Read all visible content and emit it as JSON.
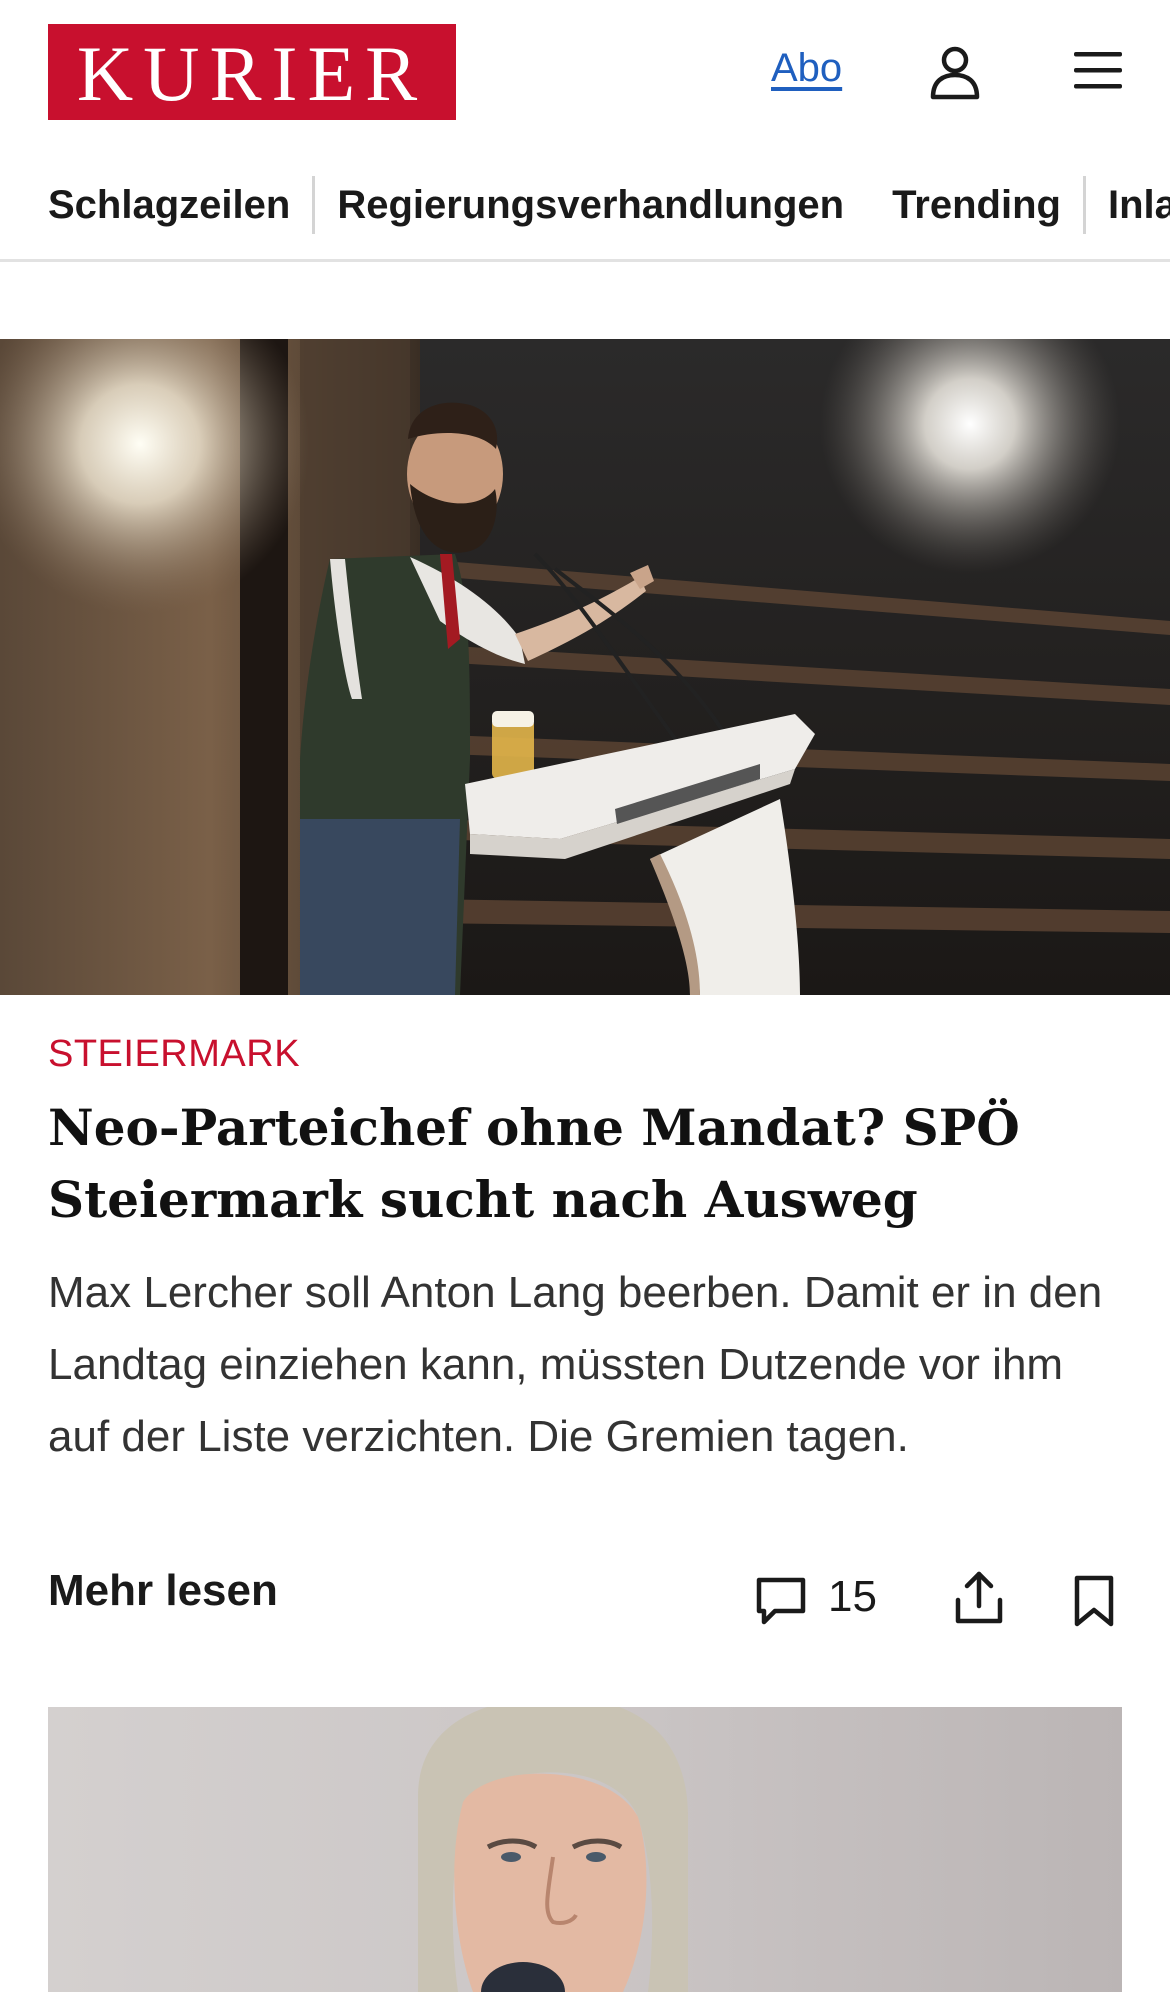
{
  "header": {
    "logo_text": "KURIER",
    "abo_label": "Abo",
    "brand_color": "#c8102e",
    "icons": {
      "account": "user-icon",
      "menu": "hamburger-menu-icon"
    }
  },
  "nav": {
    "items": [
      {
        "label": "Schlagzeilen"
      },
      {
        "label": "Regierungsverhandlungen"
      },
      {
        "label": "Trending"
      },
      {
        "label": "Inland"
      }
    ]
  },
  "article": {
    "kicker": "STEIERMARK",
    "kicker_color": "#c8102e",
    "headline": "Neo-Parteichef ohne Mandat? SPÖ Steier­mark sucht nach Ausweg",
    "teaser": "Max Lercher soll Anton Lang beerben. Damit er in den Landtag einziehen kann, müssten Dutzende vor ihm auf der Liste verzichten. Die Gremien tagen.",
    "more_label": "Mehr lesen",
    "comment_count": "15",
    "icons": {
      "comments": "comment-icon",
      "share": "share-icon",
      "bookmark": "bookmark-icon"
    }
  }
}
